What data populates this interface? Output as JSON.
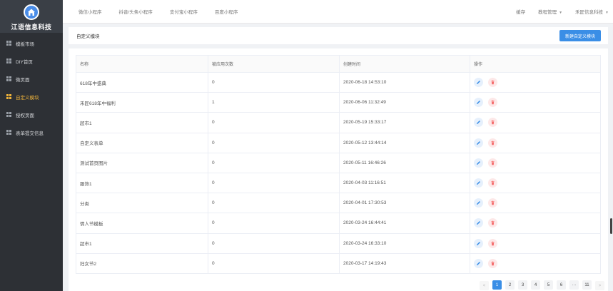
{
  "sidebar": {
    "brand": "江语信息科技",
    "items": [
      {
        "label": "模板市场",
        "active": false
      },
      {
        "label": "DIY首页",
        "active": false
      },
      {
        "label": "微页面",
        "active": false
      },
      {
        "label": "自定义模块",
        "active": true
      },
      {
        "label": "授权页面",
        "active": false
      },
      {
        "label": "表单提交信息",
        "active": false
      }
    ]
  },
  "topbar": {
    "tabs": [
      "微信小程序",
      "抖音/头条小程序",
      "支付宝小程序",
      "百度小程序"
    ],
    "cache": "缓存",
    "admin": "教程管理",
    "user": "禾匠信息科技"
  },
  "header": {
    "title": "自定义模块",
    "new_button": "新建自定义模块"
  },
  "table": {
    "columns": [
      "名称",
      "被应用次数",
      "创建时间",
      "操作"
    ],
    "rows": [
      {
        "name": "618年中盛典",
        "count": "0",
        "time": "2020-06-18 14:53:10"
      },
      {
        "name": "禾匠618年中福利",
        "count": "1",
        "time": "2020-06-06 11:32:49"
      },
      {
        "name": "超市1",
        "count": "0",
        "time": "2020-05-19 15:33:17"
      },
      {
        "name": "自定义表单",
        "count": "0",
        "time": "2020-05-12 13:44:14"
      },
      {
        "name": "测试首页图片",
        "count": "0",
        "time": "2020-05-11 16:46:26"
      },
      {
        "name": "服饰1",
        "count": "0",
        "time": "2020-04-03 11:16:51"
      },
      {
        "name": "分类",
        "count": "0",
        "time": "2020-04-01 17:30:53"
      },
      {
        "name": "情人节模板",
        "count": "0",
        "time": "2020-03-24 16:44:41"
      },
      {
        "name": "超市1",
        "count": "0",
        "time": "2020-03-24 16:33:10"
      },
      {
        "name": "妇女节2",
        "count": "0",
        "time": "2020-03-17 14:19:43"
      }
    ]
  },
  "pagination": {
    "prev": "<",
    "pages": [
      "1",
      "2",
      "3",
      "4",
      "5",
      "6",
      "···",
      "11"
    ],
    "current": "1",
    "next": ">"
  },
  "colors": {
    "sidebar_bg": "#2d3035",
    "active": "#f0b43a",
    "primary": "#3a8ee6",
    "edit_icon": "#3a8ee6",
    "delete_icon": "#f56c6c"
  },
  "icons": {
    "logo": "house-logo-icon",
    "edit": "pencil-icon",
    "delete": "trash-icon"
  }
}
